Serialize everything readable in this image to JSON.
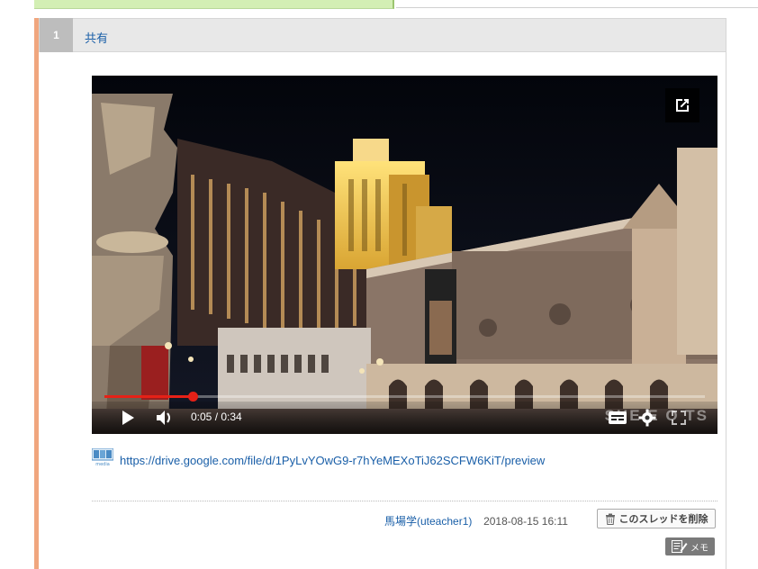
{
  "thread": {
    "number": "1",
    "title": "共有"
  },
  "video": {
    "time": "0:05 / 0:34",
    "progress": 0.147,
    "watermark": "SHE  E O TS"
  },
  "media": {
    "icon_label": "media",
    "link": "https://drive.google.com/file/d/1PyLvYOwG9-r7hYeMEXoTiJ62SCFW6KiT/preview"
  },
  "post": {
    "author": "馬場学(uteacher1)",
    "timestamp": "2018-08-15 16:11",
    "delete_label": "このスレッドを削除",
    "memo_label": "メモ"
  },
  "icons": {
    "popout": "open-in-new-icon",
    "play": "play-icon",
    "volume": "volume-icon",
    "captions": "captions-icon",
    "settings": "gear-icon",
    "fullscreen": "fullscreen-icon",
    "trash": "trash-icon",
    "memo": "memo-icon"
  },
  "colors": {
    "accent_border": "#f0a67e",
    "progress": "#e62117",
    "link": "#1a5fa8"
  }
}
